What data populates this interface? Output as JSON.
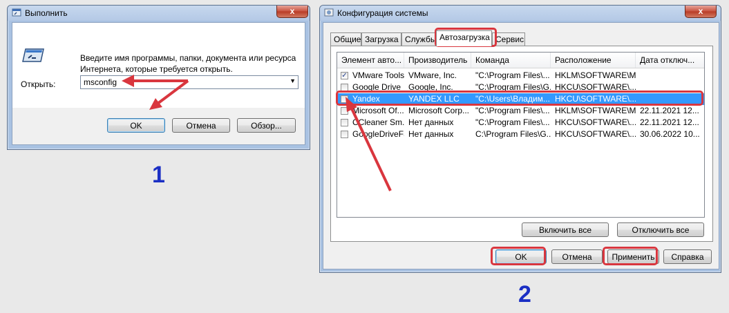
{
  "run_dialog": {
    "title": "Выполнить",
    "close_label": "x",
    "description": "Введите имя программы, папки, документа или ресурса Интернета, которые требуется открыть.",
    "open_label": "Открыть:",
    "command_value": "msconfig",
    "buttons": {
      "ok": "OK",
      "cancel": "Отмена",
      "browse": "Обзор..."
    },
    "step_number": "1",
    "icon": "run-icon"
  },
  "msconfig": {
    "title": "Конфигурация системы",
    "close_label": "x",
    "tabs": [
      "Общие",
      "Загрузка",
      "Службы",
      "Автозагрузка",
      "Сервис"
    ],
    "active_tab": "Автозагрузка",
    "columns": [
      "Элемент авто...",
      "Производитель",
      "Команда",
      "Расположение",
      "Дата отключ..."
    ],
    "rows": [
      {
        "checked": true,
        "cells": [
          "VMware Tools",
          "VMware, Inc.",
          "\"C:\\Program Files\\...",
          "HKLM\\SOFTWARE\\M...",
          ""
        ]
      },
      {
        "checked": false,
        "cells": [
          "Google Drive",
          "Google, Inc.",
          "\"C:\\Program Files\\G...",
          "HKCU\\SOFTWARE\\...",
          ""
        ]
      },
      {
        "checked": false,
        "selected": true,
        "cells": [
          "Yandex",
          "YANDEX LLC",
          "\"C:\\Users\\Владим...",
          "HKCU\\SOFTWARE\\...",
          ""
        ]
      },
      {
        "checked": false,
        "cells": [
          "Microsoft Of...",
          "Microsoft Corp...",
          "\"C:\\Program Files\\...",
          "HKLM\\SOFTWARE\\M...",
          "22.11.2021 12..."
        ]
      },
      {
        "checked": false,
        "cells": [
          "CCleaner Sm...",
          "Нет данных",
          "\"C:\\Program Files\\...",
          "HKCU\\SOFTWARE\\...",
          "22.11.2021 12..."
        ]
      },
      {
        "checked": false,
        "cells": [
          "GoogleDriveFS",
          "Нет данных",
          "C:\\Program Files\\G...",
          "HKCU\\SOFTWARE\\...",
          "30.06.2022 10..."
        ]
      }
    ],
    "panel_buttons": {
      "enable_all": "Включить все",
      "disable_all": "Отключить все"
    },
    "buttons": {
      "ok": "OK",
      "cancel": "Отмена",
      "apply": "Применить",
      "help": "Справка"
    },
    "step_number": "2",
    "icon": "system-config-icon"
  },
  "colors": {
    "annotation_red": "#d9363e",
    "step_blue": "#1b2fc4",
    "selection": "#3399ff"
  }
}
